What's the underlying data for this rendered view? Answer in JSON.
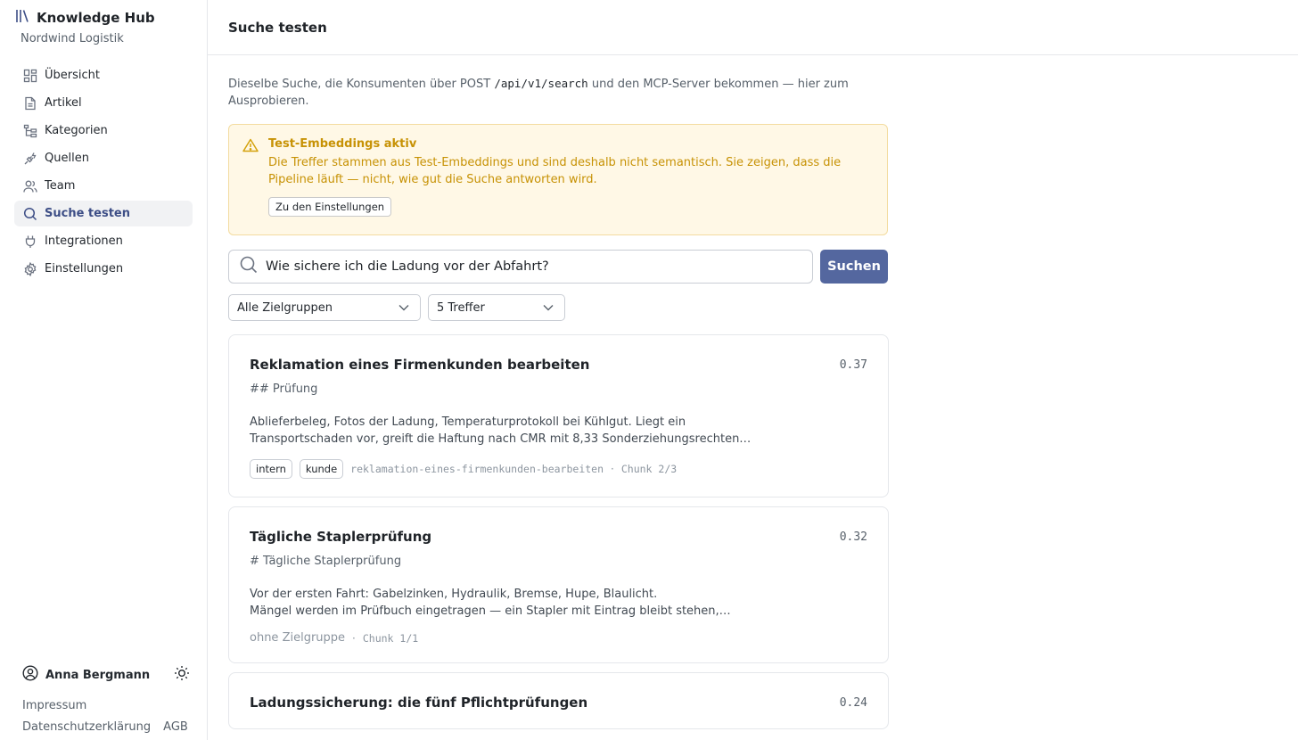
{
  "app": {
    "title": "Knowledge Hub",
    "org": "Nordwind Logistik"
  },
  "sidebar": {
    "items": [
      {
        "label": "Übersicht",
        "icon": "grid-icon"
      },
      {
        "label": "Artikel",
        "icon": "document-icon"
      },
      {
        "label": "Kategorien",
        "icon": "tree-icon"
      },
      {
        "label": "Quellen",
        "icon": "plug-spark-icon"
      },
      {
        "label": "Team",
        "icon": "users-icon"
      },
      {
        "label": "Suche testen",
        "icon": "search-icon",
        "active": true
      },
      {
        "label": "Integrationen",
        "icon": "plug-icon"
      },
      {
        "label": "Einstellungen",
        "icon": "gear-icon"
      }
    ],
    "user": {
      "name": "Anna Bergmann"
    },
    "footer": {
      "impressum": "Impressum",
      "privacy": "Datenschutzerklärung",
      "terms": "AGB"
    }
  },
  "header": {
    "title": "Suche testen"
  },
  "intro": {
    "before": "Dieselbe Suche, die Konsumenten über POST ",
    "code": "/api/v1/search",
    "after": " und den MCP-Server bekommen — hier zum Ausprobieren."
  },
  "warning": {
    "title": "Test-Embeddings aktiv",
    "text": "Die Treffer stammen aus Test-Embeddings und sind deshalb nicht semantisch. Sie zeigen, dass die Pipeline läuft — nicht, wie gut die Suche antworten wird.",
    "button": "Zu den Einstellungen"
  },
  "search": {
    "query": "Wie sichere ich die Ladung vor der Abfahrt?",
    "button": "Suchen"
  },
  "filters": {
    "audience": "Alle Zielgruppen",
    "count": "5 Treffer"
  },
  "results": [
    {
      "title": "Reklamation eines Firmenkunden bearbeiten",
      "score": "0.37",
      "heading": "## Prüfung",
      "snippet_line1": "Ablieferbeleg, Fotos der Ladung, Temperaturprotokoll bei Kühlgut. Liegt ein",
      "snippet_line2": "Transportschaden vor, greift die Haftung nach CMR mit 8,33 Sonderziehungsrechten…",
      "tags": [
        "intern",
        "kunde"
      ],
      "slug": "reklamation-eines-firmenkunden-bearbeiten",
      "chunk": "Chunk 2/3"
    },
    {
      "title": "Tägliche Staplerprüfung",
      "score": "0.32",
      "heading": "# Tägliche Staplerprüfung",
      "snippet_line1": "Vor der ersten Fahrt: Gabelzinken, Hydraulik, Bremse, Hupe, Blaulicht.",
      "snippet_line2": "Mängel werden im Prüfbuch eingetragen — ein Stapler mit Eintrag bleibt stehen,…",
      "audience": "ohne Zielgruppe",
      "chunk": "Chunk 1/1"
    },
    {
      "title": "Ladungssicherung: die fünf Pflichtprüfungen",
      "score": "0.24"
    }
  ],
  "separator": "·",
  "colors": {
    "accent": "#54679f",
    "active_nav": "#3d4e86",
    "warning_text": "#c79205",
    "warning_bg": "#fff8e6"
  }
}
